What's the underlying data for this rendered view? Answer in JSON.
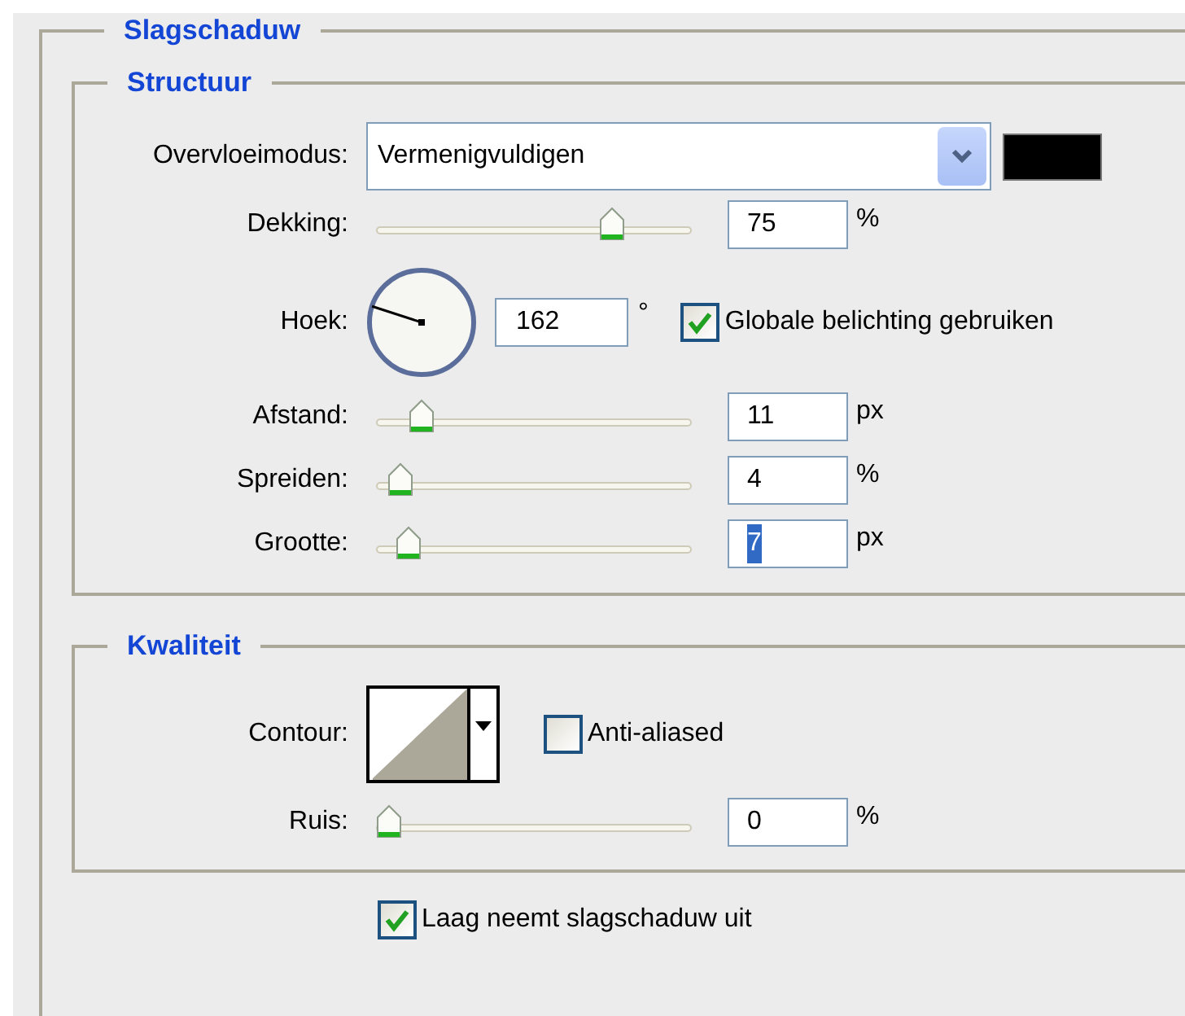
{
  "section_title": "Slagschaduw",
  "structure": {
    "title": "Structuur",
    "blend_mode": {
      "label": "Overvloeimodus:",
      "value": "Vermenigvuldigen",
      "color": "#000000"
    },
    "opacity": {
      "label": "Dekking:",
      "level": 0.77,
      "value": "75",
      "unit": "%",
      "value_selected": false
    },
    "angle": {
      "label": "Hoek:",
      "value": "162",
      "unit": "°",
      "global_light": {
        "label": "Globale belichting gebruiken",
        "checked": true
      }
    },
    "sliders": [
      {
        "label": "Afstand:",
        "level": 0.11,
        "value": "11",
        "unit": "px",
        "value_selected": false
      },
      {
        "label": "Spreiden:",
        "level": 0.04,
        "value": "4",
        "unit": "%",
        "value_selected": false
      },
      {
        "label": "Grootte:",
        "level": 0.07,
        "value": "7",
        "unit": "px",
        "value_selected": true
      }
    ]
  },
  "quality": {
    "title": "Kwaliteit",
    "contour": {
      "label": "Contour:"
    },
    "anti_aliased": {
      "label": "Anti-aliased",
      "checked": false
    },
    "noise": {
      "label": "Ruis:",
      "level": 0,
      "value": "0",
      "unit": "%",
      "value_selected": false
    }
  },
  "knockout": {
    "label": "Laag neemt slagschaduw uit",
    "checked": true
  }
}
